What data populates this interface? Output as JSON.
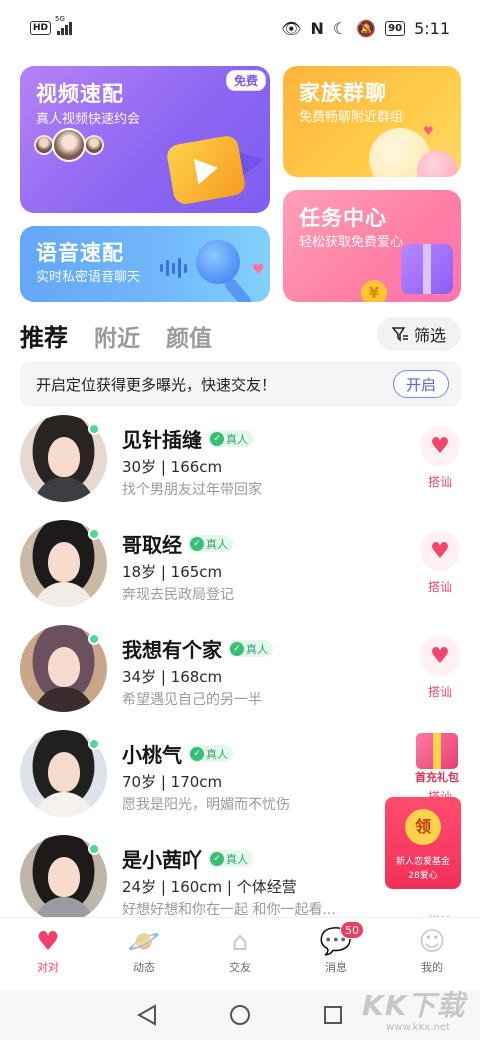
{
  "status_bar": {
    "hd": "HD",
    "network": "5G",
    "battery": "90",
    "time": "5:11"
  },
  "cards": {
    "video": {
      "title": "视频速配",
      "subtitle": "真人视频快速约会",
      "badge": "免费"
    },
    "family": {
      "title": "家族群聊",
      "subtitle": "免费畅聊附近群组"
    },
    "voice": {
      "title": "语音速配",
      "subtitle": "实时私密语音聊天"
    },
    "task": {
      "title": "任务中心",
      "subtitle": "轻松获取免费爱心",
      "coin": "¥"
    }
  },
  "tabs": [
    {
      "label": "推荐",
      "active": true
    },
    {
      "label": "附近",
      "active": false
    },
    {
      "label": "颜值",
      "active": false
    }
  ],
  "filter": {
    "label": "筛选"
  },
  "location_banner": {
    "text": "开启定位获得更多曝光，快速交友！",
    "button": "开启"
  },
  "verified_label": "真人",
  "greet_label": "搭讪",
  "users": [
    {
      "name": "见针插缝",
      "info": "30岁 | 166cm",
      "motto": "找个男朋友过年带回家",
      "hair": "#2a2422",
      "top": "#3d3d46",
      "bg": "#e7d9cf"
    },
    {
      "name": "哥取经",
      "info": "18岁 | 165cm",
      "motto": "奔现去民政局登记",
      "hair": "#1c1a1b",
      "top": "#f1ece8",
      "bg": "#cbb9a8"
    },
    {
      "name": "我想有个家",
      "info": "34岁 | 168cm",
      "motto": "希望遇见自己的另一半",
      "hair": "#6b5060",
      "top": "#3b2d2d",
      "bg": "#c9a58a"
    },
    {
      "name": "小桃气",
      "info": "70岁 | 170cm",
      "motto": "愿我是阳光，明媚而不忧伤",
      "hair": "#22201f",
      "top": "#f5f1ee",
      "bg": "#dde3e8"
    },
    {
      "name": "是小茜吖",
      "info": "24岁 | 160cm | 个体经营",
      "motto": "好想好想和你在一起 和你一起看...",
      "hair": "#1f1a19",
      "top": "#9c9aa3",
      "bg": "#bfb5a8"
    }
  ],
  "gift_promo": {
    "label": "首充礼包"
  },
  "red_packet": {
    "symbol": "领",
    "line1": "新人恋爱基金",
    "line2": "28爱心"
  },
  "bottom_nav": [
    {
      "label": "对对",
      "icon": "heart-icon",
      "active": true
    },
    {
      "label": "动态",
      "icon": "planet-icon",
      "active": false
    },
    {
      "label": "交友",
      "icon": "home-icon",
      "active": false
    },
    {
      "label": "消息",
      "icon": "message-icon",
      "active": false,
      "badge": "50"
    },
    {
      "label": "我的",
      "icon": "profile-icon",
      "active": false
    }
  ],
  "watermark": {
    "logo": "KK下载",
    "url": "www.kkx.net"
  }
}
